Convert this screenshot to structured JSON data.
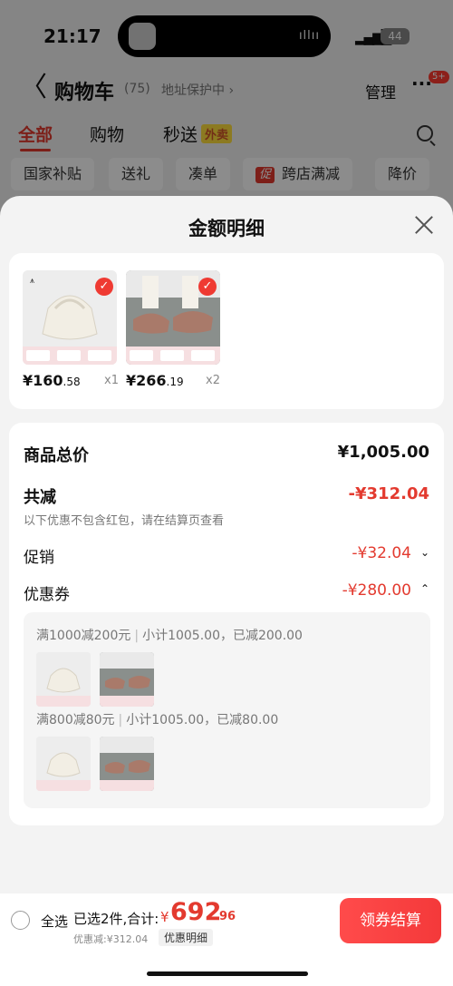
{
  "status_bar": {
    "time": "21:17",
    "battery": "44"
  },
  "nav": {
    "back": "〈",
    "title": "购物车",
    "count": "(75)",
    "address_protect": "地址保护中 ›",
    "manage": "管理",
    "more": "···",
    "more_badge": "5+"
  },
  "tabs": [
    {
      "label": "全部",
      "active": true
    },
    {
      "label": "购物",
      "active": false
    },
    {
      "label": "秒送",
      "active": false
    }
  ],
  "tab_tag": "外卖",
  "chips": [
    "国家补贴",
    "送礼",
    "凑单",
    "跨店满减",
    "降价"
  ],
  "chip_promo_badge": "促",
  "sheet": {
    "title": "金额明细",
    "products": [
      {
        "name": "bag",
        "price_int": "¥160",
        "price_dec": ".58",
        "qty": "x1"
      },
      {
        "name": "shoes",
        "price_int": "¥266",
        "price_dec": ".19",
        "qty": "x2"
      }
    ],
    "check_mark": "✓",
    "summary": {
      "total_label": "商品总价",
      "total_value": "¥1,005.00",
      "reduce_label": "共减",
      "reduce_value": "-¥312.04",
      "note": "以下优惠不包含红包，请在结算页查看",
      "promo_label": "促销",
      "promo_value": "-¥32.04",
      "coupon_label": "优惠券",
      "coupon_value": "-¥280.00"
    },
    "coupons": [
      {
        "rule": "满1000减200元",
        "detail": "小计1005.00，已减200.00"
      },
      {
        "rule": "满800减80元",
        "detail": "小计1005.00，已减80.00"
      }
    ]
  },
  "bottom_bar": {
    "select_all": "全选",
    "selected": "已选2件,合计:",
    "yen": "¥",
    "total_int": "692",
    "total_dec": ".96",
    "discount": "优惠减:¥312.04",
    "detail_button": "优惠明细",
    "checkout": "领券结算"
  },
  "colors": {
    "accent_red": "#e33a2f",
    "checkout_red": "#f4393a"
  }
}
